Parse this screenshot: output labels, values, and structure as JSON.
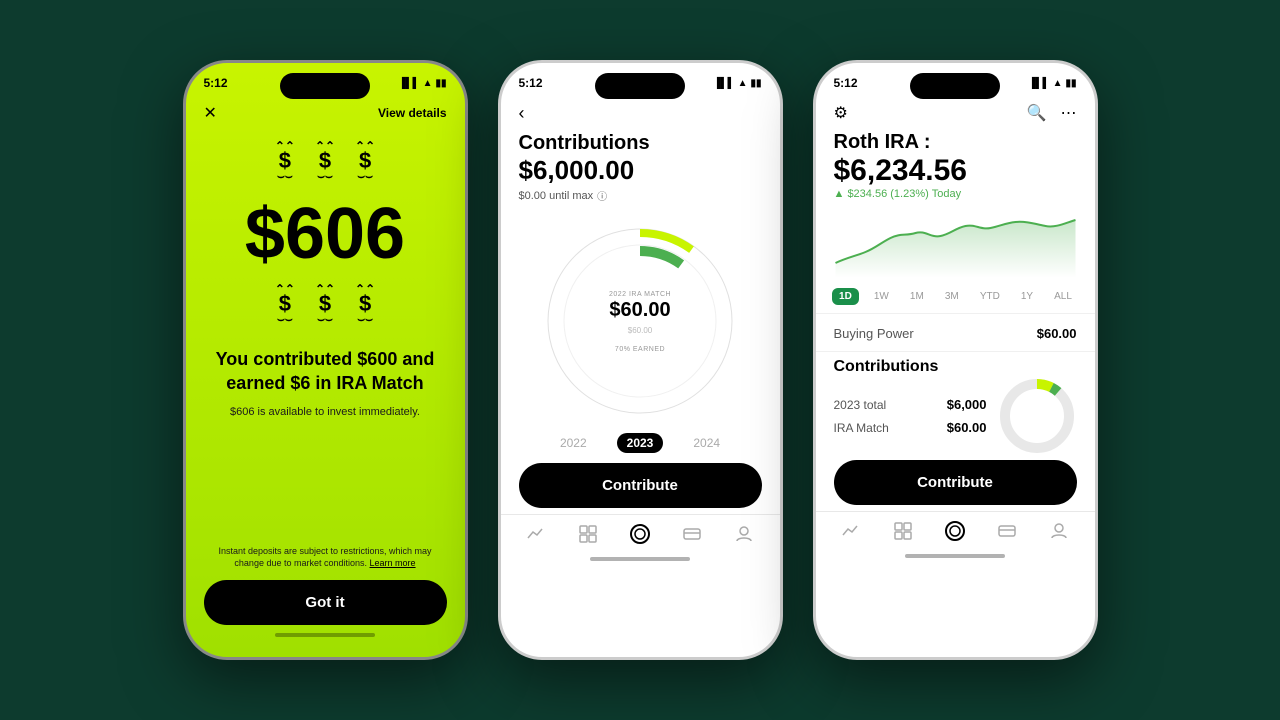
{
  "background": "#0d3b2e",
  "phone1": {
    "status_time": "5:12",
    "close_icon": "✕",
    "view_details": "View details",
    "big_amount": "$606",
    "description_main": "You contributed $600 and earned $6 in IRA Match",
    "description_sub": "$606 is available to invest immediately.",
    "disclaimer": "Instant deposits are subject to restrictions, which may change due to market conditions.",
    "disclaimer_link": "Learn more",
    "got_it_label": "Got it"
  },
  "phone2": {
    "status_time": "5:12",
    "back_icon": "‹",
    "title": "Contributions",
    "amount": "$6,000.00",
    "max_label": "$0.00 until max",
    "center_amount": "$60.00",
    "center_label": "2022 IRA MATCH",
    "center_sub_label": "70% EARNED",
    "years": [
      "2022",
      "2023",
      "2024"
    ],
    "active_year": "2023",
    "contribute_label": "Contribute",
    "nav_icons": [
      "chart",
      "grid",
      "circle",
      "card",
      "person"
    ]
  },
  "phone3": {
    "status_time": "5:12",
    "title": "Roth IRA :",
    "amount": "$6,234.56",
    "change": "▲ $234.56 (1.23%)",
    "change_period": "Today",
    "time_ranges": [
      "1D",
      "1W",
      "1M",
      "3M",
      "YTD",
      "1Y",
      "ALL"
    ],
    "active_range": "1D",
    "buying_power_label": "Buying Power",
    "buying_power_value": "$60.00",
    "contributions_title": "Contributions",
    "total_2023_label": "2023 total",
    "total_2023_value": "$6,000",
    "ira_match_label": "IRA Match",
    "ira_match_value": "$60.00",
    "contribute_label": "Contribute",
    "nav_icons": [
      "chart",
      "grid",
      "circle",
      "card",
      "person"
    ]
  }
}
